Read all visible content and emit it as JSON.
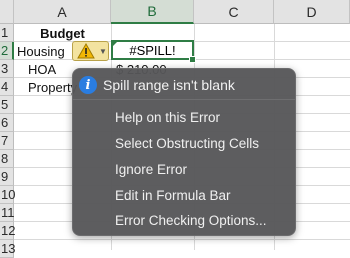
{
  "columns": [
    "A",
    "B",
    "C",
    "D"
  ],
  "rows": [
    "1",
    "2",
    "3",
    "4",
    "5",
    "6",
    "7",
    "8",
    "9",
    "10",
    "11",
    "12",
    "13"
  ],
  "cells": {
    "a1": "Budget",
    "a2": "Housing",
    "a3": "HOA",
    "a4": "Property",
    "b2": "#SPILL!",
    "b3": "$    210.00"
  },
  "error_menu": {
    "title": "Spill range isn't blank",
    "items": [
      "Help on this Error",
      "Select Obstructing Cells",
      "Ignore Error",
      "Edit in Formula Bar",
      "Error Checking Options..."
    ]
  },
  "colors": {
    "accent": "#2f7d45",
    "info": "#2a7de1",
    "menu_bg": "#565658"
  }
}
